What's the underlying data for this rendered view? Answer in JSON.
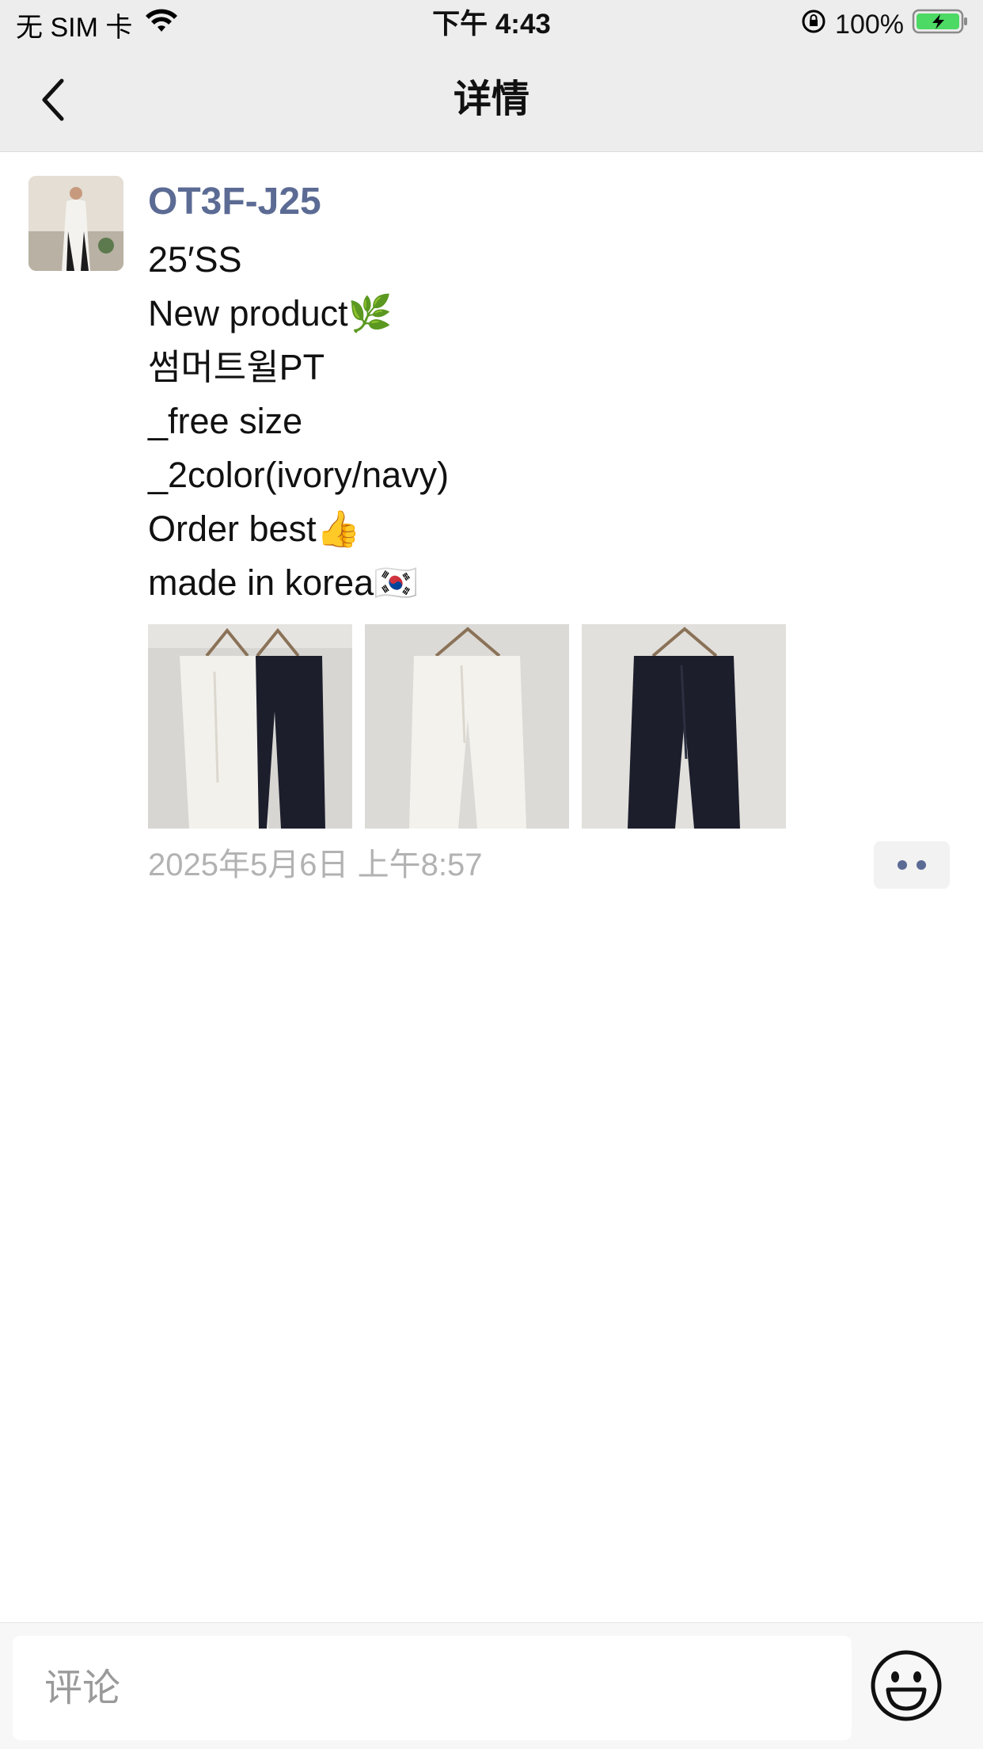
{
  "status_bar": {
    "carrier": "无 SIM 卡",
    "time": "下午 4:43",
    "battery": "100%"
  },
  "nav": {
    "title": "详情"
  },
  "post": {
    "username": "OT3F-J25",
    "lines": [
      "25′SS",
      "New product🌿",
      "썸머트윌PT",
      "_free size",
      "_2color(ivory/navy)",
      "Order best👍",
      "made in korea🇰🇷"
    ],
    "timestamp": "2025年5月6日 上午8:57",
    "photos": [
      "ivory-and-navy-pants",
      "ivory-pants",
      "navy-pants"
    ]
  },
  "comment": {
    "placeholder": "评论"
  },
  "colors": {
    "username": "#5b6b94",
    "bar_background": "#ededed",
    "timestamp": "#b2b2b2",
    "battery": "#4cd964"
  }
}
